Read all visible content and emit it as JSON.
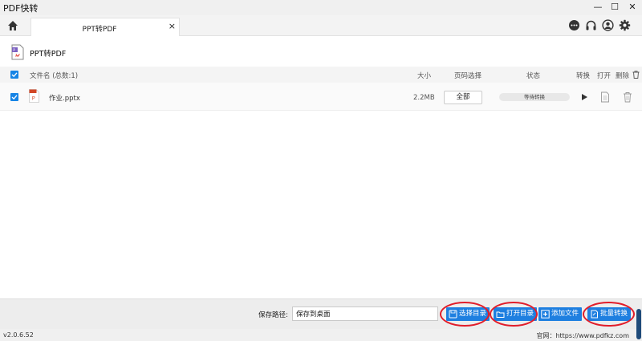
{
  "window": {
    "title": "PDF快转",
    "minimize": "—",
    "maximize": "☐",
    "close": "✕"
  },
  "tabs": [
    {
      "label": "PPT转PDF",
      "close": "×"
    }
  ],
  "page": {
    "title": "PPT转PDF"
  },
  "list": {
    "headers": {
      "filename": "文件名 (总数:1)",
      "size": "大小",
      "page_select": "页码选择",
      "status": "状态",
      "convert": "转换",
      "open": "打开",
      "delete": "删除"
    },
    "rows": [
      {
        "name": "作业.pptx",
        "size": "2.2MB",
        "pages": "全部",
        "status": "等待转换",
        "checked": true
      }
    ]
  },
  "bottom": {
    "save_label": "保存路径:",
    "save_value": "保存到桌面",
    "buttons": {
      "choose_dir": "选择目录",
      "open_dir": "打开目录",
      "add_file": "添加文件",
      "batch_convert": "批量转换"
    }
  },
  "footer": {
    "version": "v2.0.6.52",
    "website": "官网：https://www.pdfkz.com"
  },
  "colors": {
    "accent": "#1e7fe0",
    "checkbox": "#1684e5",
    "highlight": "#e11d2a"
  },
  "icons": [
    "home-icon",
    "chat-icon",
    "headset-icon",
    "user-icon",
    "gear-icon",
    "ppt-pdf-icon",
    "pptx-file-icon",
    "play-icon",
    "document-icon",
    "trash-icon",
    "save-dir-icon",
    "folder-icon",
    "plus-icon",
    "batch-icon"
  ]
}
